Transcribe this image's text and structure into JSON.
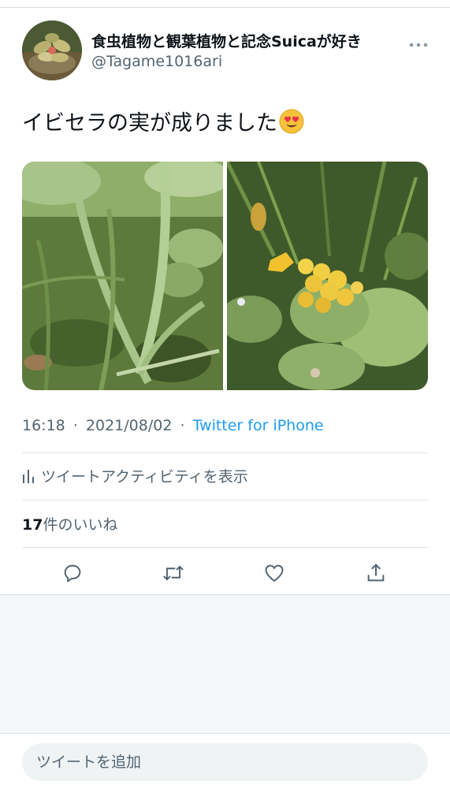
{
  "tweet": {
    "display_name": "食虫植物と観葉植物と記念Suicaが好き",
    "handle": "@Tagame1016ari",
    "text": "イビセラの実が成りました",
    "emoji": "smiling-face-with-heart-eyes-icon",
    "time": "16:18",
    "date": "2021/08/02",
    "separator": "·",
    "source": "Twitter for iPhone",
    "activity_label": "ツイートアクティビティを表示",
    "likes_count": "17",
    "likes_suffix": "件のいいね"
  },
  "actions": [
    {
      "name": "reply-icon"
    },
    {
      "name": "retweet-icon"
    },
    {
      "name": "like-icon"
    },
    {
      "name": "share-icon"
    }
  ],
  "reply_bar": {
    "placeholder": "ツイートを追加"
  },
  "colors": {
    "text": "#0f1419",
    "secondary": "#536471",
    "link": "#1d9bf0",
    "divider": "#dfe3e6",
    "input_bg": "#eff3f4"
  }
}
